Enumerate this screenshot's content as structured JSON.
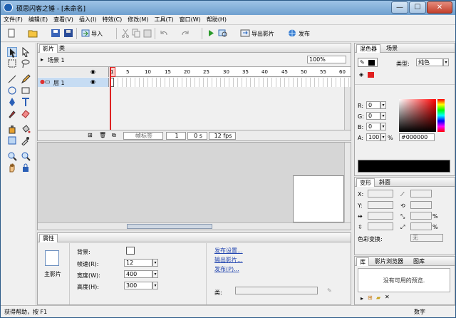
{
  "title": "硕思闪客之锤 - [未命名]",
  "window_buttons": {
    "min": "—",
    "max": "☐",
    "close": "✕"
  },
  "menu": [
    "文件(F)",
    "编辑(E)",
    "查看(V)",
    "插入(I)",
    "特效(C)",
    "修改(M)",
    "工具(T)",
    "窗口(W)",
    "帮助(H)"
  ],
  "toolbar": {
    "import": "导入",
    "export_movie": "导出影片",
    "publish": "发布"
  },
  "timeline": {
    "tabs": [
      "影片",
      "类"
    ],
    "scene": "场景 1",
    "zoom": "100%",
    "layer": "层 1",
    "frame_numbers": [
      "1",
      "5",
      "10",
      "15",
      "20",
      "25",
      "30",
      "35",
      "40",
      "45",
      "50",
      "55",
      "60"
    ],
    "frame_label": "帧标签",
    "current_frame": "1",
    "time": "0 s",
    "fps": "12 fps"
  },
  "properties": {
    "tab": "属性",
    "icon_label": "主影片",
    "background_label": "背景:",
    "frame_rate_label": "帧速(R):",
    "frame_rate": "12",
    "width_label": "宽度(W):",
    "width": "400",
    "height_label": "高度(H):",
    "height": "300",
    "publish_settings": "发布设置...",
    "export_movie": "输出影片...",
    "publish": "发布(P)...",
    "class_label": "类:"
  },
  "mixer": {
    "tabs": [
      "混色器",
      "场景"
    ],
    "type_label": "类型:",
    "type_value": "纯色",
    "r_label": "R:",
    "r": "0",
    "g_label": "G:",
    "g": "0",
    "b_label": "B:",
    "b": "0",
    "a_label": "A:",
    "a": "100",
    "percent": "%",
    "hex": "#000000",
    "swatch_color": "#000000"
  },
  "transform": {
    "tabs": [
      "变形",
      "斜面"
    ],
    "x_label": "X:",
    "y_label": "Y:",
    "color_transform_label": "色彩变换:",
    "color_transform_value": "无",
    "percent": "%"
  },
  "library": {
    "tabs": [
      "库",
      "影片浏览器",
      "图库"
    ],
    "empty_message": "没有可用的预览."
  },
  "status": {
    "help": "获得帮助，按 F1",
    "numlock": "数字"
  }
}
